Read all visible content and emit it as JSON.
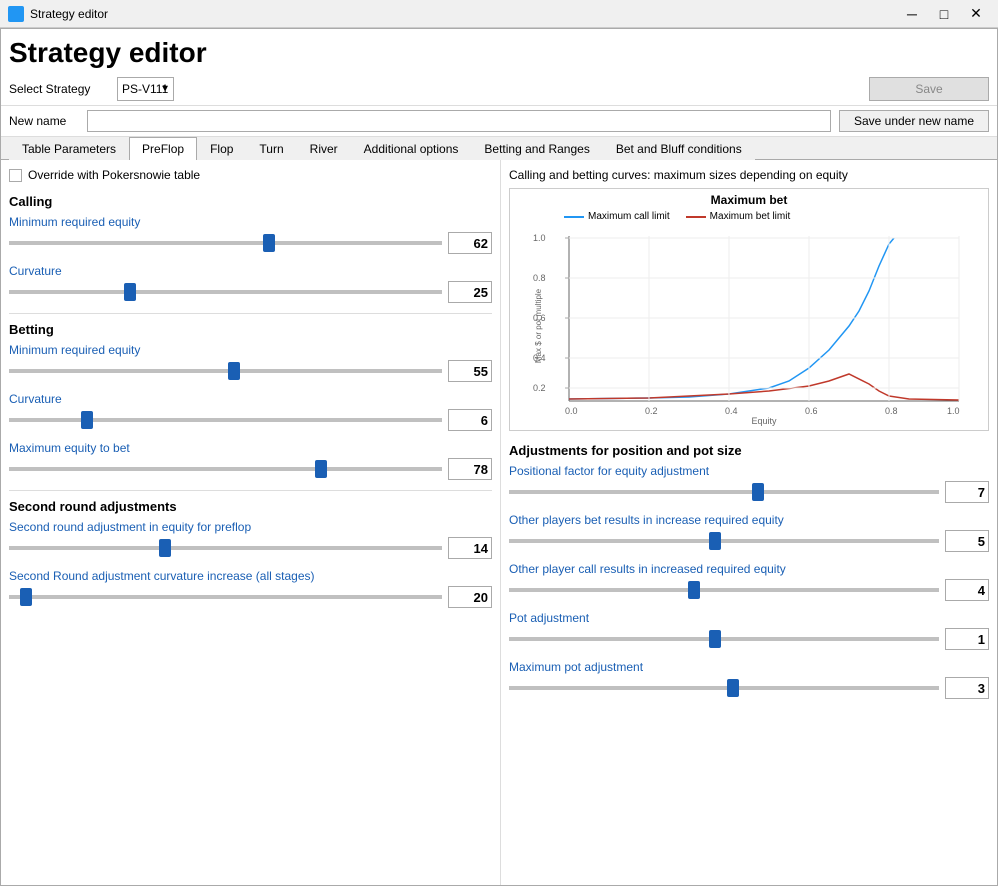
{
  "titleBar": {
    "icon": "strategy-icon",
    "title": "Strategy editor",
    "controls": {
      "minimize": "─",
      "maximize": "□",
      "close": "✕"
    }
  },
  "appTitle": "Strategy editor",
  "toolbar": {
    "selectLabel": "Select Strategy",
    "strategyOptions": [
      "PS-V111"
    ],
    "selectedStrategy": "PS-V111",
    "saveLabel": "Save"
  },
  "newName": {
    "label": "New name",
    "placeholder": "",
    "saveUnderLabel": "Save under new name"
  },
  "tabs": [
    {
      "id": "table-parameters",
      "label": "Table Parameters"
    },
    {
      "id": "preflop",
      "label": "PreFlop",
      "active": true
    },
    {
      "id": "flop",
      "label": "Flop"
    },
    {
      "id": "turn",
      "label": "Turn"
    },
    {
      "id": "river",
      "label": "River"
    },
    {
      "id": "additional-options",
      "label": "Additional options"
    },
    {
      "id": "betting-and-ranges",
      "label": "Betting and Ranges"
    },
    {
      "id": "bet-and-bluff",
      "label": "Bet and Bluff conditions"
    }
  ],
  "overrideCheckbox": {
    "label": "Override with Pokersnowie table",
    "checked": false
  },
  "calling": {
    "title": "Calling",
    "minRequiredEquity": {
      "label": "Minimum required equity",
      "value": "62",
      "thumbPosition": 0.6
    },
    "curvature": {
      "label": "Curvature",
      "value": "25",
      "thumbPosition": 0.28
    }
  },
  "betting": {
    "title": "Betting",
    "minRequiredEquity": {
      "label": "Minimum required equity",
      "value": "55",
      "thumbPosition": 0.52
    },
    "curvature": {
      "label": "Curvature",
      "value": "6",
      "thumbPosition": 0.18
    },
    "maxEquityToBet": {
      "label": "Maximum equity to bet",
      "value": "78",
      "thumbPosition": 0.72
    }
  },
  "secondRound": {
    "title": "Second round adjustments",
    "equityForPreflop": {
      "label": "Second round adjustment in equity for preflop",
      "value": "14",
      "thumbPosition": 0.36
    },
    "curvatureIncrease": {
      "label": "Second Round adjustment curvature increase (all stages)",
      "value": "20",
      "thumbPosition": 0.04
    }
  },
  "chart": {
    "title": "Calling and betting curves: maximum sizes depending on equity",
    "chartTitle": "Maximum bet",
    "legend": [
      {
        "label": "Maximum call limit",
        "color": "#2196F3"
      },
      {
        "label": "Maximum bet limit",
        "color": "#c0392b"
      }
    ]
  },
  "adjustments": {
    "title": "Adjustments for position and pot size",
    "positionalFactor": {
      "label": "Positional factor for equity adjustment",
      "value": "7",
      "thumbPosition": 0.58
    },
    "otherPlayersBetResult": {
      "label": "Other players bet results in increase required equity",
      "value": "5",
      "thumbPosition": 0.48
    },
    "otherPlayerCallResult": {
      "label": "Other player call results in increased required equity",
      "value": "4",
      "thumbPosition": 0.43
    },
    "potAdjustment": {
      "label": "Pot adjustment",
      "value": "1",
      "thumbPosition": 0.48
    },
    "maxPotAdjustment": {
      "label": "Maximum pot adjustment",
      "value": "3",
      "thumbPosition": 0.52
    }
  }
}
